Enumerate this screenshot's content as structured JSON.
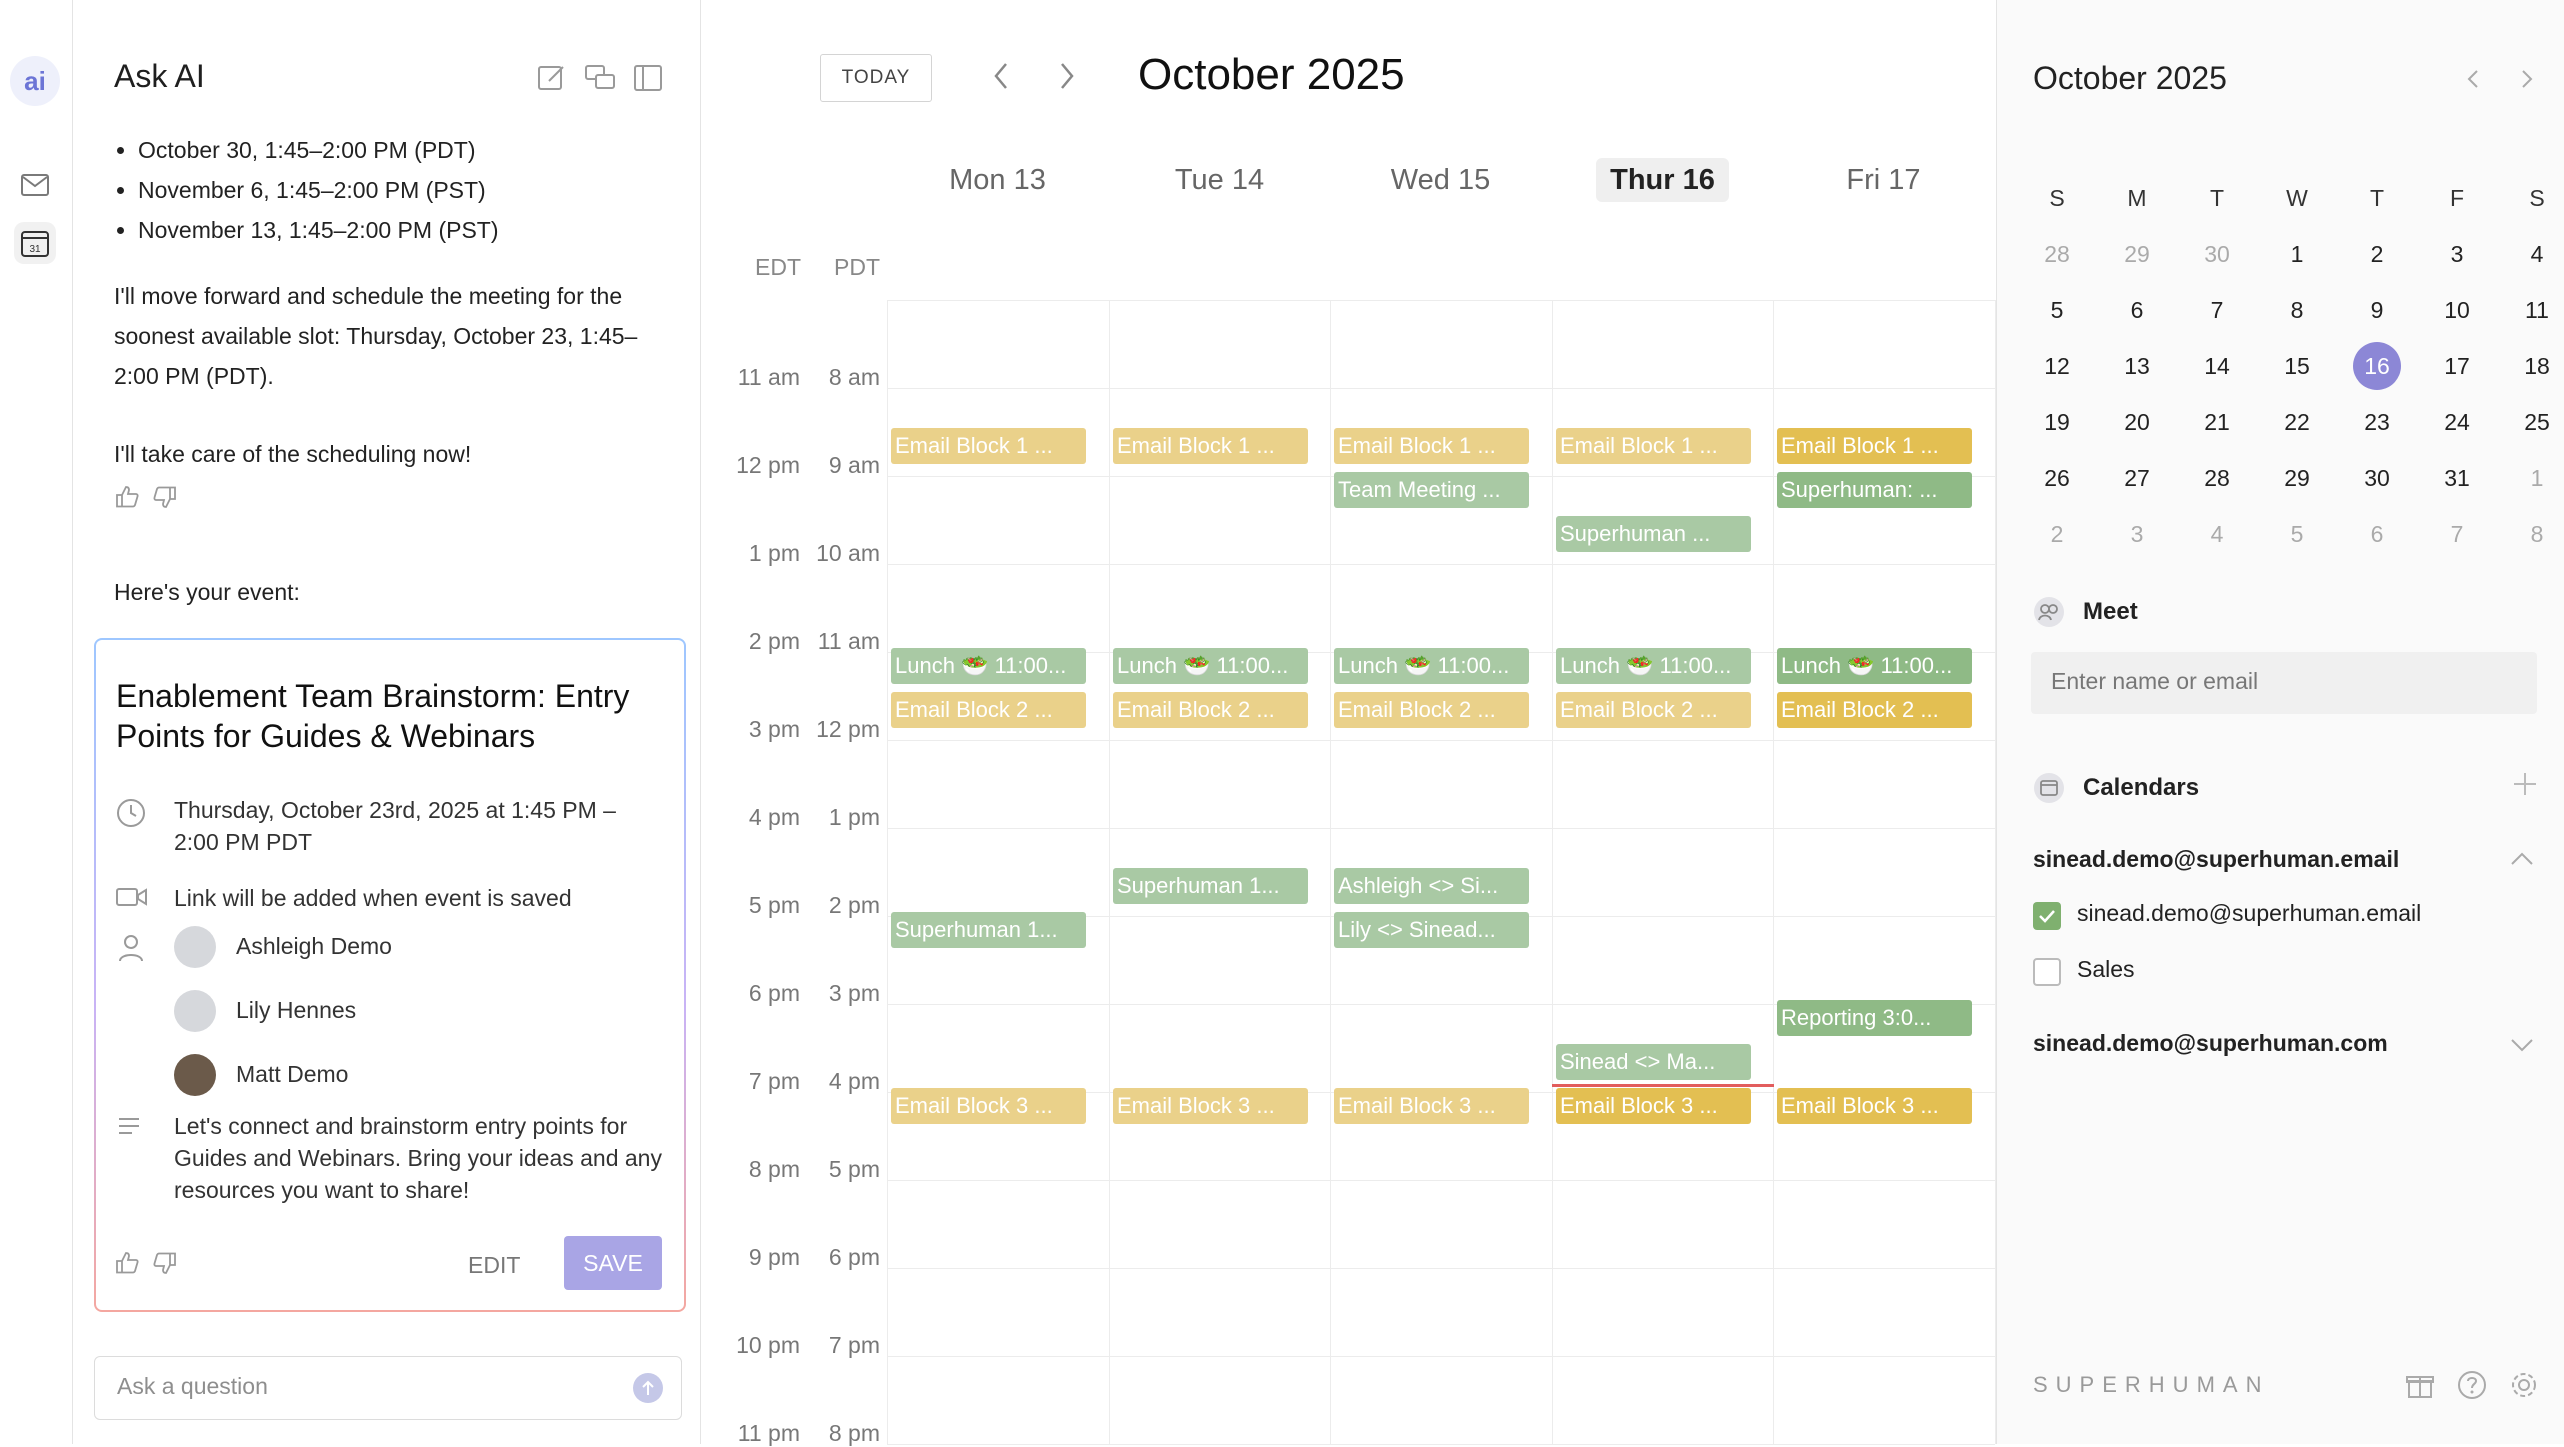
{
  "rail": {
    "ai_label": "ai",
    "icons": [
      "mail-icon",
      "calendar-icon"
    ],
    "calendar_icon_text": "31"
  },
  "askai": {
    "title": "Ask AI",
    "header_icons": [
      "compose-icon",
      "chats-icon",
      "sidebar-toggle-icon"
    ],
    "bullets": [
      "October 30, 1:45–2:00 PM (PDT)",
      "November 6, 1:45–2:00 PM (PST)",
      "November 13, 1:45–2:00 PM (PST)"
    ],
    "message_1": "I'll move forward and schedule the meeting for the soonest available slot: Thursday, October 23, 1:45–2:00 PM (PDT).",
    "message_2": "I'll take care of the scheduling now!",
    "message_3": "Here's your event:",
    "event_card": {
      "title": "Enablement Team Brainstorm: Entry Points for Guides & Webinars",
      "datetime": "Thursday, October 23rd, 2025 at 1:45 PM – 2:00 PM PDT",
      "link_note": "Link will be added when event is saved",
      "attendees": [
        "Ashleigh Demo",
        "Lily Hennes",
        "Matt Demo"
      ],
      "description": "Let's connect and brainstorm entry points for Guides and Webinars. Bring your ideas and any resources you want to share!",
      "edit_label": "EDIT",
      "save_label": "SAVE"
    },
    "input_placeholder": "Ask a question"
  },
  "calendar": {
    "today_label": "TODAY",
    "month_title": "October 2025",
    "days": [
      {
        "label": "Mon 13",
        "today": false
      },
      {
        "label": "Tue 14",
        "today": false
      },
      {
        "label": "Wed 15",
        "today": false
      },
      {
        "label": "Thur 16",
        "today": true
      },
      {
        "label": "Fri 17",
        "today": false
      }
    ],
    "tz_primary": "EDT",
    "tz_secondary": "PDT",
    "hours": [
      {
        "edt": "11 am",
        "pdt": "8 am"
      },
      {
        "edt": "12 pm",
        "pdt": "9 am"
      },
      {
        "edt": "1 pm",
        "pdt": "10 am"
      },
      {
        "edt": "2 pm",
        "pdt": "11 am"
      },
      {
        "edt": "3 pm",
        "pdt": "12 pm"
      },
      {
        "edt": "4 pm",
        "pdt": "1 pm"
      },
      {
        "edt": "5 pm",
        "pdt": "2 pm"
      },
      {
        "edt": "6 pm",
        "pdt": "3 pm"
      },
      {
        "edt": "7 pm",
        "pdt": "4 pm"
      },
      {
        "edt": "8 pm",
        "pdt": "5 pm"
      },
      {
        "edt": "9 pm",
        "pdt": "6 pm"
      },
      {
        "edt": "10 pm",
        "pdt": "7 pm"
      },
      {
        "edt": "11 pm",
        "pdt": "8 pm"
      }
    ],
    "events": [
      {
        "day": 0,
        "text": "Email Block 1 ...",
        "color": "yellow"
      },
      {
        "day": 1,
        "text": "Email Block 1 ...",
        "color": "yellow"
      },
      {
        "day": 2,
        "text": "Email Block 1 ...",
        "color": "yellow"
      },
      {
        "day": 3,
        "text": "Email Block 1 ...",
        "color": "yellow"
      },
      {
        "day": 4,
        "text": "Email Block 1 ...",
        "color": "yellow2"
      },
      {
        "day": 2,
        "text": "Team Meeting ...",
        "color": "green"
      },
      {
        "day": 4,
        "text": "Superhuman: ...",
        "color": "green2"
      },
      {
        "day": 3,
        "text": "Superhuman ...",
        "color": "green"
      },
      {
        "day": 0,
        "text": "Lunch 🥗 11:00...",
        "color": "green"
      },
      {
        "day": 1,
        "text": "Lunch 🥗 11:00...",
        "color": "green"
      },
      {
        "day": 2,
        "text": "Lunch 🥗 11:00...",
        "color": "green"
      },
      {
        "day": 3,
        "text": "Lunch 🥗 11:00...",
        "color": "green"
      },
      {
        "day": 4,
        "text": "Lunch 🥗 11:00...",
        "color": "green2"
      },
      {
        "day": 0,
        "text": "Email Block 2 ...",
        "color": "yellow"
      },
      {
        "day": 1,
        "text": "Email Block 2 ...",
        "color": "yellow"
      },
      {
        "day": 2,
        "text": "Email Block 2 ...",
        "color": "yellow"
      },
      {
        "day": 3,
        "text": "Email Block 2 ...",
        "color": "yellow"
      },
      {
        "day": 4,
        "text": "Email Block 2 ...",
        "color": "yellow2"
      },
      {
        "day": 1,
        "text": "Superhuman 1...",
        "color": "green"
      },
      {
        "day": 2,
        "text": "Ashleigh <> Si...",
        "color": "green"
      },
      {
        "day": 0,
        "text": "Superhuman 1...",
        "color": "green"
      },
      {
        "day": 2,
        "text": "Lily <> Sinead...",
        "color": "green"
      },
      {
        "day": 4,
        "text": "Reporting 3:0...",
        "color": "green2"
      },
      {
        "day": 3,
        "text": "Sinead <> Ma...",
        "color": "green"
      },
      {
        "day": 0,
        "text": "Email Block 3 ...",
        "color": "yellow"
      },
      {
        "day": 1,
        "text": "Email Block 3 ...",
        "color": "yellow"
      },
      {
        "day": 2,
        "text": "Email Block 3 ...",
        "color": "yellow"
      },
      {
        "day": 3,
        "text": "Email Block 3 ...",
        "color": "yellow2"
      },
      {
        "day": 4,
        "text": "Email Block 3 ...",
        "color": "yellow2"
      }
    ]
  },
  "sidebar": {
    "mini_title": "October 2025",
    "weekdays": [
      "S",
      "M",
      "T",
      "W",
      "T",
      "F",
      "S"
    ],
    "weeks": [
      [
        "28",
        "29",
        "30",
        "1",
        "2",
        "3",
        "4"
      ],
      [
        "5",
        "6",
        "7",
        "8",
        "9",
        "10",
        "11"
      ],
      [
        "12",
        "13",
        "14",
        "15",
        "16",
        "17",
        "18"
      ],
      [
        "19",
        "20",
        "21",
        "22",
        "23",
        "24",
        "25"
      ],
      [
        "26",
        "27",
        "28",
        "29",
        "30",
        "31",
        "1"
      ],
      [
        "2",
        "3",
        "4",
        "5",
        "6",
        "7",
        "8"
      ]
    ],
    "selected_day": "16",
    "meet_label": "Meet",
    "meet_placeholder": "Enter name or email",
    "calendars_label": "Calendars",
    "account_1": "sinead.demo@superhuman.email",
    "calendar_items": [
      {
        "label": "sinead.demo@superhuman.email",
        "checked": true
      },
      {
        "label": "Sales",
        "checked": false
      }
    ],
    "account_2": "sinead.demo@superhuman.com",
    "brand": "SUPERHUMAN",
    "footer_icons": [
      "gift-icon",
      "help-icon",
      "settings-icon"
    ]
  },
  "colors": {
    "accent": "#8c87d6",
    "event_yellow": "#ead18a",
    "event_green": "#a9c9a4",
    "now_line": "#e25d5d"
  }
}
